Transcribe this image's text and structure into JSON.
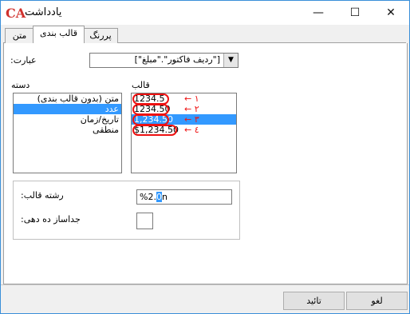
{
  "window": {
    "title": "یادداشت",
    "logo": "CA",
    "minimize": "—",
    "maximize": "☐",
    "close": "✕"
  },
  "tabs": [
    {
      "label": "متن"
    },
    {
      "label": "قالب بندی"
    },
    {
      "label": "پررنگ"
    }
  ],
  "expression": {
    "label": ":عبارت",
    "value": "[\"ردیف فاکتور\".\"مبلغ\"]"
  },
  "category": {
    "label": "دسته",
    "items": [
      "متن (بدون قالب بندی)",
      "عدد",
      "تاریخ/زمان",
      "منطقی"
    ],
    "selected": "عدد"
  },
  "format": {
    "label": "قالب",
    "items": [
      "1234.5",
      "1234.50",
      "1,234.50",
      "$1,234.50"
    ],
    "selected": "1,234.50"
  },
  "annotations": [
    "← ۱",
    "← ۲",
    "← ۳",
    "← ٤"
  ],
  "format_string": {
    "label": ":رشته قالب",
    "value_prefix": "%2.",
    "value_selected": "0",
    "value_suffix": "n"
  },
  "thousands_sep": {
    "label": ":جداساز ده دهی",
    "value": ""
  },
  "buttons": {
    "ok": "تائید",
    "cancel": "لغو"
  },
  "colors": {
    "selection": "#3399ff",
    "annotation": "#e11111"
  }
}
